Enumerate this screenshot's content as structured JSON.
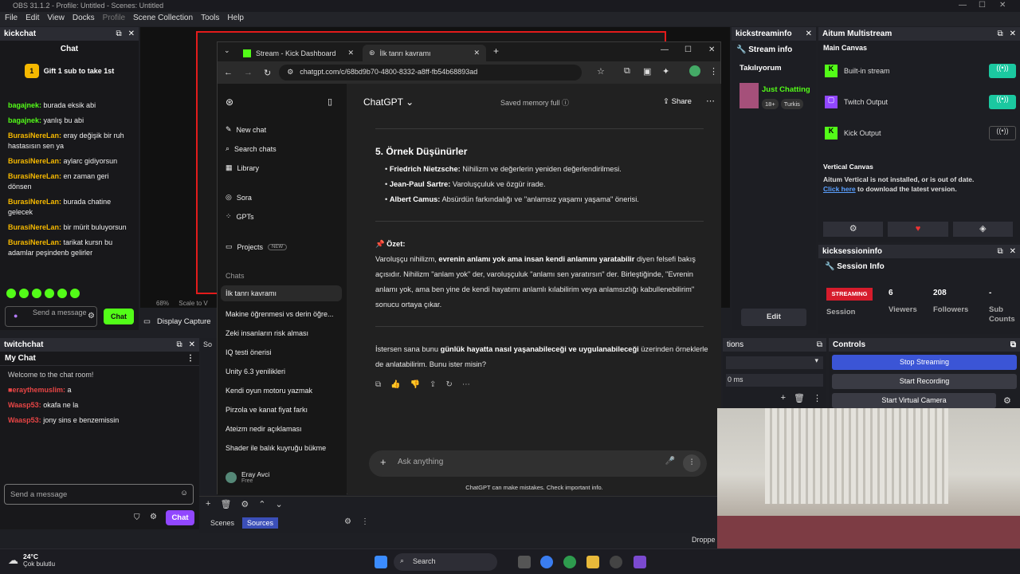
{
  "obs": {
    "title": "OBS 31.1.2 - Profile: Untitled - Scenes: Untitled",
    "menu": [
      "File",
      "Edit",
      "View",
      "Docks",
      "Profile",
      "Scene Collection",
      "Tools",
      "Help"
    ],
    "display_capture": "Display Capture",
    "zoom": "68%",
    "scale_to": "Scale to V",
    "scenes_tab": "Scenes",
    "sources_tab": "Sources",
    "dropped": "Droppe",
    "ms_label": "0 ms",
    "sources_header": "So",
    "scenes_header_partial": "tions"
  },
  "kickchat": {
    "dock_title": "kickchat",
    "header": "Chat",
    "gift_text": "Gift 1 sub to take 1st",
    "gift_badge": "1",
    "messages": [
      {
        "user": "bagajnek:",
        "text": "burada eksik abi"
      },
      {
        "user": "bagajnek:",
        "text": "yanlış bu abi"
      },
      {
        "user": "BurasiNereLan:",
        "text": "eray değişik bir ruh hastasısın sen ya"
      },
      {
        "user": "BurasiNereLan:",
        "text": "aylarc gidiyorsun"
      },
      {
        "user": "BurasiNereLan:",
        "text": "en zaman geri dönsen"
      },
      {
        "user": "BurasiNereLan:",
        "text": "burada chatine gelecek"
      },
      {
        "user": "BurasiNereLan:",
        "text": "bir mürit buluyorsun"
      },
      {
        "user": "BurasiNereLan:",
        "text": "tarikat kursn bu adamlar peşindenb gelirler"
      }
    ],
    "send_placeholder": "Send a message",
    "chat_button": "Chat"
  },
  "twitchchat": {
    "dock_title": "twitchchat",
    "header": "My Chat",
    "welcome": "Welcome to the chat room!",
    "messages": [
      {
        "user": "eraythemuslim:",
        "text": " a"
      },
      {
        "user": "Waasp53:",
        "text": " okafa ne la"
      },
      {
        "user": "Waasp53:",
        "text": " jony sins e benzemissin"
      }
    ],
    "send_placeholder": "Send a message",
    "chat_button": "Chat"
  },
  "browser": {
    "tabs": [
      "Stream - Kick Dashboard",
      "İlk tanrı kavramı"
    ],
    "url": "chatgpt.com/c/68bd9b70-4800-8332-a8ff-fb54b68893ad"
  },
  "chatgpt": {
    "model": "ChatGPT",
    "memory": "Saved memory full",
    "share": "Share",
    "nav": [
      "New chat",
      "Search chats",
      "Library",
      "Sora",
      "GPTs",
      "Projects"
    ],
    "new_badge": "NEW",
    "chats_label": "Chats",
    "chats": [
      "İlk tanrı kavramı",
      "Makine öğrenmesi vs derin öğre...",
      "Zeki insanların risk alması",
      "IQ testi önerisi",
      "Unity 6.3 yenilikleri",
      "Kendi oyun motoru yazmak",
      "Pirzola ve kanat fiyat farkı",
      "Ateizm nedir açıklaması",
      "Shader ile balık kuyruğu bükme"
    ],
    "user_name": "Eray Avci",
    "user_plan": "Free",
    "section_title": "5. Örnek Düşünürler",
    "thinkers": [
      {
        "name": "Friedrich Nietzsche:",
        "text": " Nihilizm ve değerlerin yeniden değerlendirilmesi."
      },
      {
        "name": "Jean-Paul Sartre:",
        "text": " Varoluşçuluk ve özgür irade."
      },
      {
        "name": "Albert Camus:",
        "text": " Absürdün farkındalığı ve \"anlamsız yaşamı yaşama\" önerisi."
      }
    ],
    "summary_title": "Özet:",
    "summary_1": "Varoluşçu nihilizm, ",
    "summary_bold": "evrenin anlamı yok ama insan kendi anlamını yaratabilir",
    "summary_2": " diyen felsefi bakış açısıdır. Nihilizm \"anlam yok\" der, varoluşçuluk \"anlamı sen yaratırsın\" der. Birleştiğinde, \"Evrenin anlamı yok, ama ben yine de kendi hayatımı anlamlı kılabilirim veya anlamsızlığı kabullenebilirim\" sonucu ortaya çıkar.",
    "question_1": "İstersen sana bunu ",
    "question_bold": "günlük hayatta nasıl yaşanabileceği ve uygulanabileceği",
    "question_2": " üzerinden örneklerle de anlatabilirim. Bunu ister misin?",
    "ask_placeholder": "Ask anything",
    "disclaimer": "ChatGPT can make mistakes. Check important info."
  },
  "kickstreaminfo": {
    "dock_title": "kickstreaminfo",
    "header": "Stream info",
    "category_label": "Takılıyorum",
    "category": "Just Chatting",
    "tags": [
      "18+",
      "Turkis"
    ]
  },
  "aitum": {
    "dock_title": "Aitum Multistream",
    "main_canvas": "Main Canvas",
    "outputs": [
      "Built-in stream",
      "Twitch Output",
      "Kick Output"
    ],
    "vertical_title": "Vertical Canvas",
    "vertical_msg": "Aitum Vertical is not installed, or is out of date.",
    "vertical_link": "Click here",
    "vertical_link_rest": " to download the latest version."
  },
  "kicksession": {
    "dock_title": "kicksessioninfo",
    "header": "Session Info",
    "streaming": "STREAMING",
    "session": "Session",
    "stats": [
      {
        "value": "6",
        "label": "Viewers"
      },
      {
        "value": "208",
        "label": "Followers"
      },
      {
        "value": "-",
        "label": "Sub Counts"
      }
    ],
    "edit": "Edit"
  },
  "controls": {
    "dock_title": "Controls",
    "buttons": [
      "Stop Streaming",
      "Start Recording",
      "Start Virtual Camera"
    ]
  },
  "taskbar": {
    "weather_temp": "24°C",
    "weather_desc": "Çok bulutlu",
    "search": "Search"
  }
}
